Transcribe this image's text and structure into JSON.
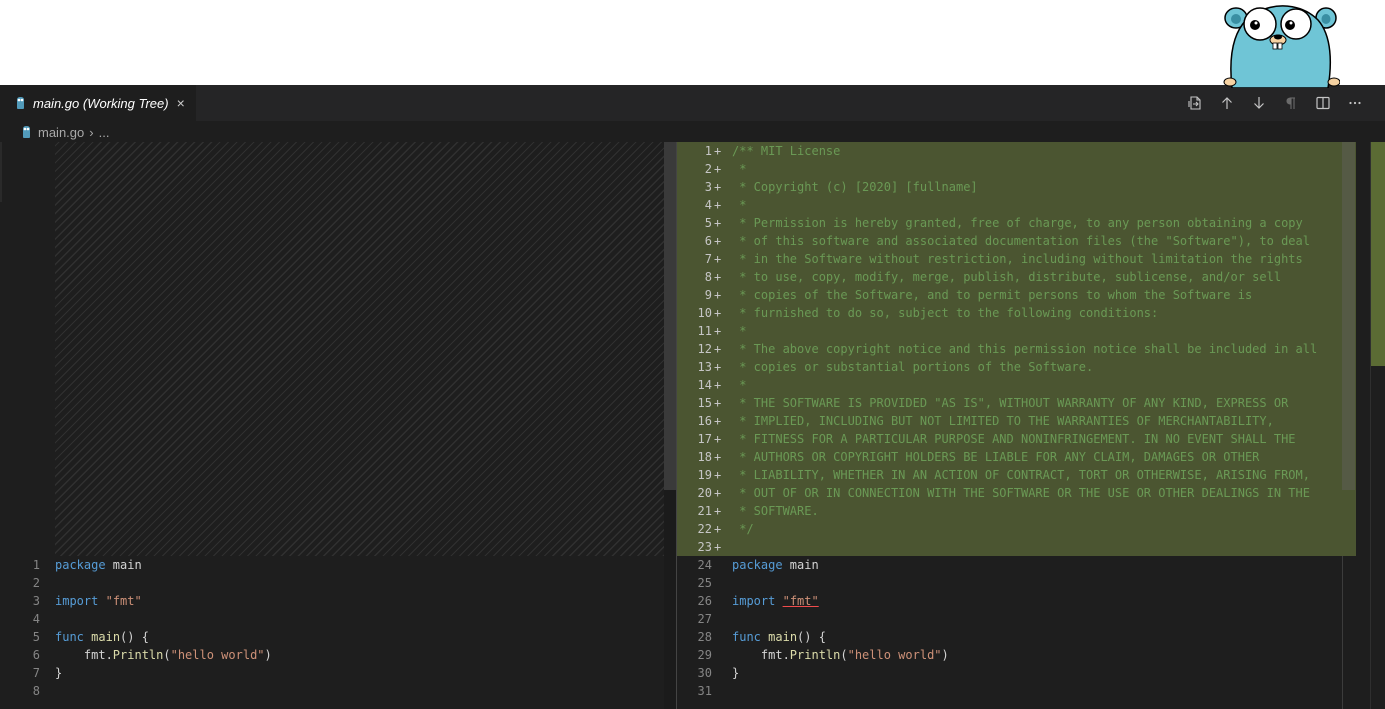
{
  "tab": {
    "label": "main.go (Working Tree)",
    "close": "×"
  },
  "breadcrumb": {
    "file": "main.go",
    "separator": "›",
    "rest": "..."
  },
  "toolbar_icons": [
    "open-file-icon",
    "previous-change-icon",
    "next-change-icon",
    "show-whitespace-icon",
    "split-editor-icon",
    "more-actions-icon"
  ],
  "colors": {
    "added_background": "#4b5531",
    "editor_background": "#1e1e1e",
    "comment": "#6a9955",
    "keyword": "#569cd6",
    "string": "#ce9178",
    "function": "#dcdcaa"
  },
  "left_pane": {
    "lines": [
      {
        "num": "1",
        "tokens": [
          {
            "t": "package",
            "c": "kw"
          },
          {
            "t": " main",
            "c": ""
          }
        ]
      },
      {
        "num": "2",
        "tokens": []
      },
      {
        "num": "3",
        "tokens": [
          {
            "t": "import",
            "c": "kw"
          },
          {
            "t": " ",
            "c": ""
          },
          {
            "t": "\"fmt\"",
            "c": "str"
          }
        ]
      },
      {
        "num": "4",
        "tokens": []
      },
      {
        "num": "5",
        "tokens": [
          {
            "t": "func",
            "c": "kw"
          },
          {
            "t": " ",
            "c": ""
          },
          {
            "t": "main",
            "c": "fn"
          },
          {
            "t": "() {",
            "c": ""
          }
        ]
      },
      {
        "num": "6",
        "tokens": [
          {
            "t": "    fmt.",
            "c": ""
          },
          {
            "t": "Println",
            "c": "fn"
          },
          {
            "t": "(",
            "c": ""
          },
          {
            "t": "\"hello world\"",
            "c": "str"
          },
          {
            "t": ")",
            "c": ""
          }
        ]
      },
      {
        "num": "7",
        "tokens": [
          {
            "t": "}",
            "c": ""
          }
        ]
      },
      {
        "num": "8",
        "tokens": []
      }
    ]
  },
  "right_pane": {
    "added_lines": [
      {
        "num": "1",
        "text": "/** MIT License"
      },
      {
        "num": "2",
        "text": " *"
      },
      {
        "num": "3",
        "text": " * Copyright (c) [2020] [fullname]"
      },
      {
        "num": "4",
        "text": " *"
      },
      {
        "num": "5",
        "text": " * Permission is hereby granted, free of charge, to any person obtaining a copy"
      },
      {
        "num": "6",
        "text": " * of this software and associated documentation files (the \"Software\"), to deal"
      },
      {
        "num": "7",
        "text": " * in the Software without restriction, including without limitation the rights"
      },
      {
        "num": "8",
        "text": " * to use, copy, modify, merge, publish, distribute, sublicense, and/or sell"
      },
      {
        "num": "9",
        "text": " * copies of the Software, and to permit persons to whom the Software is"
      },
      {
        "num": "10",
        "text": " * furnished to do so, subject to the following conditions:"
      },
      {
        "num": "11",
        "text": " *"
      },
      {
        "num": "12",
        "text": " * The above copyright notice and this permission notice shall be included in all"
      },
      {
        "num": "13",
        "text": " * copies or substantial portions of the Software."
      },
      {
        "num": "14",
        "text": " *"
      },
      {
        "num": "15",
        "text": " * THE SOFTWARE IS PROVIDED \"AS IS\", WITHOUT WARRANTY OF ANY KIND, EXPRESS OR"
      },
      {
        "num": "16",
        "text": " * IMPLIED, INCLUDING BUT NOT LIMITED TO THE WARRANTIES OF MERCHANTABILITY,"
      },
      {
        "num": "17",
        "text": " * FITNESS FOR A PARTICULAR PURPOSE AND NONINFRINGEMENT. IN NO EVENT SHALL THE"
      },
      {
        "num": "18",
        "text": " * AUTHORS OR COPYRIGHT HOLDERS BE LIABLE FOR ANY CLAIM, DAMAGES OR OTHER"
      },
      {
        "num": "19",
        "text": " * LIABILITY, WHETHER IN AN ACTION OF CONTRACT, TORT OR OTHERWISE, ARISING FROM,"
      },
      {
        "num": "20",
        "text": " * OUT OF OR IN CONNECTION WITH THE SOFTWARE OR THE USE OR OTHER DEALINGS IN THE"
      },
      {
        "num": "21",
        "text": " * SOFTWARE."
      },
      {
        "num": "22",
        "text": " */"
      },
      {
        "num": "23",
        "text": ""
      }
    ],
    "plus_marker": "+",
    "lines": [
      {
        "num": "24",
        "tokens": [
          {
            "t": "package",
            "c": "kw"
          },
          {
            "t": " main",
            "c": ""
          }
        ]
      },
      {
        "num": "25",
        "tokens": []
      },
      {
        "num": "26",
        "tokens": [
          {
            "t": "import",
            "c": "kw"
          },
          {
            "t": " ",
            "c": ""
          },
          {
            "t": "\"fmt\"",
            "c": "str str-u"
          }
        ]
      },
      {
        "num": "27",
        "tokens": []
      },
      {
        "num": "28",
        "tokens": [
          {
            "t": "func",
            "c": "kw"
          },
          {
            "t": " ",
            "c": ""
          },
          {
            "t": "main",
            "c": "fn"
          },
          {
            "t": "() {",
            "c": ""
          }
        ]
      },
      {
        "num": "29",
        "tokens": [
          {
            "t": "    fmt.",
            "c": ""
          },
          {
            "t": "Println",
            "c": "fn"
          },
          {
            "t": "(",
            "c": ""
          },
          {
            "t": "\"hello world\"",
            "c": "str"
          },
          {
            "t": ")",
            "c": ""
          }
        ]
      },
      {
        "num": "30",
        "tokens": [
          {
            "t": "}",
            "c": ""
          }
        ]
      },
      {
        "num": "31",
        "tokens": []
      }
    ]
  }
}
